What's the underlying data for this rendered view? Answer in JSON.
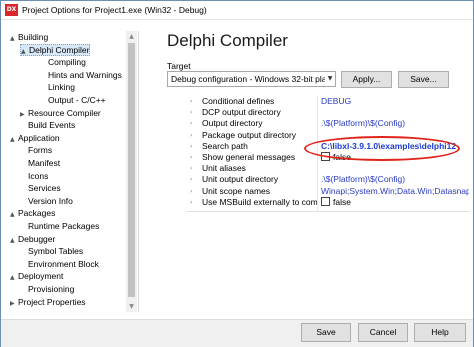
{
  "window": {
    "title": "Project Options for Project1.exe  (Win32 - Debug)",
    "app_icon_text": "DX",
    "app_icon_color": "#d8282c"
  },
  "tree": {
    "items": [
      {
        "label": "Building",
        "expander": "▲"
      },
      {
        "label": "Delphi Compiler",
        "expander": "▲"
      },
      {
        "label": "Compiling",
        "expander": ""
      },
      {
        "label": "Hints and Warnings",
        "expander": ""
      },
      {
        "label": "Linking",
        "expander": ""
      },
      {
        "label": "Output - C/C++",
        "expander": ""
      },
      {
        "label": "Resource Compiler",
        "expander": "▶"
      },
      {
        "label": "Build Events",
        "expander": ""
      },
      {
        "label": "Application",
        "expander": "▲"
      },
      {
        "label": "Forms",
        "expander": ""
      },
      {
        "label": "Manifest",
        "expander": ""
      },
      {
        "label": "Icons",
        "expander": ""
      },
      {
        "label": "Services",
        "expander": ""
      },
      {
        "label": "Version Info",
        "expander": ""
      },
      {
        "label": "Packages",
        "expander": "▲"
      },
      {
        "label": "Runtime Packages",
        "expander": ""
      },
      {
        "label": "Debugger",
        "expander": "▲"
      },
      {
        "label": "Symbol Tables",
        "expander": ""
      },
      {
        "label": "Environment Block",
        "expander": ""
      },
      {
        "label": "Deployment",
        "expander": "▲"
      },
      {
        "label": "Provisioning",
        "expander": ""
      },
      {
        "label": "Project Properties",
        "expander": "▶"
      }
    ],
    "selected": "Delphi Compiler"
  },
  "main": {
    "title": "Delphi Compiler",
    "target_label": "Target",
    "target_value": "Debug configuration - Windows 32-bit platform",
    "apply_label": "Apply...",
    "save_label": "Save..."
  },
  "properties": [
    {
      "name": "Conditional defines",
      "value": "DEBUG",
      "style": "link",
      "checkbox": false
    },
    {
      "name": "DCP output directory",
      "value": "",
      "style": "",
      "checkbox": false
    },
    {
      "name": "Output directory",
      "value": ".\\$(Platform)\\$(Config)",
      "style": "link",
      "checkbox": false
    },
    {
      "name": "Package output directory",
      "value": "",
      "style": "",
      "checkbox": false
    },
    {
      "name": "Search path",
      "value": "C:\\libxl-3.9.1.0\\examples\\delphi12",
      "style": "bold",
      "checkbox": false
    },
    {
      "name": "Show general messages",
      "value": "false",
      "style": "",
      "checkbox": true
    },
    {
      "name": "Unit aliases",
      "value": "",
      "style": "",
      "checkbox": false
    },
    {
      "name": "Unit output directory",
      "value": ".\\$(Platform)\\$(Config)",
      "style": "link",
      "checkbox": false
    },
    {
      "name": "Unit scope names",
      "value": "Winapi;System.Win;Data.Win;Datasnap",
      "style": "link",
      "checkbox": false
    },
    {
      "name": "Use MSBuild externally to compile",
      "value": "false",
      "style": "",
      "checkbox": true
    }
  ],
  "annotation_color": "#e0241b",
  "footer": {
    "save_label": "Save",
    "cancel_label": "Cancel",
    "help_label": "Help"
  }
}
